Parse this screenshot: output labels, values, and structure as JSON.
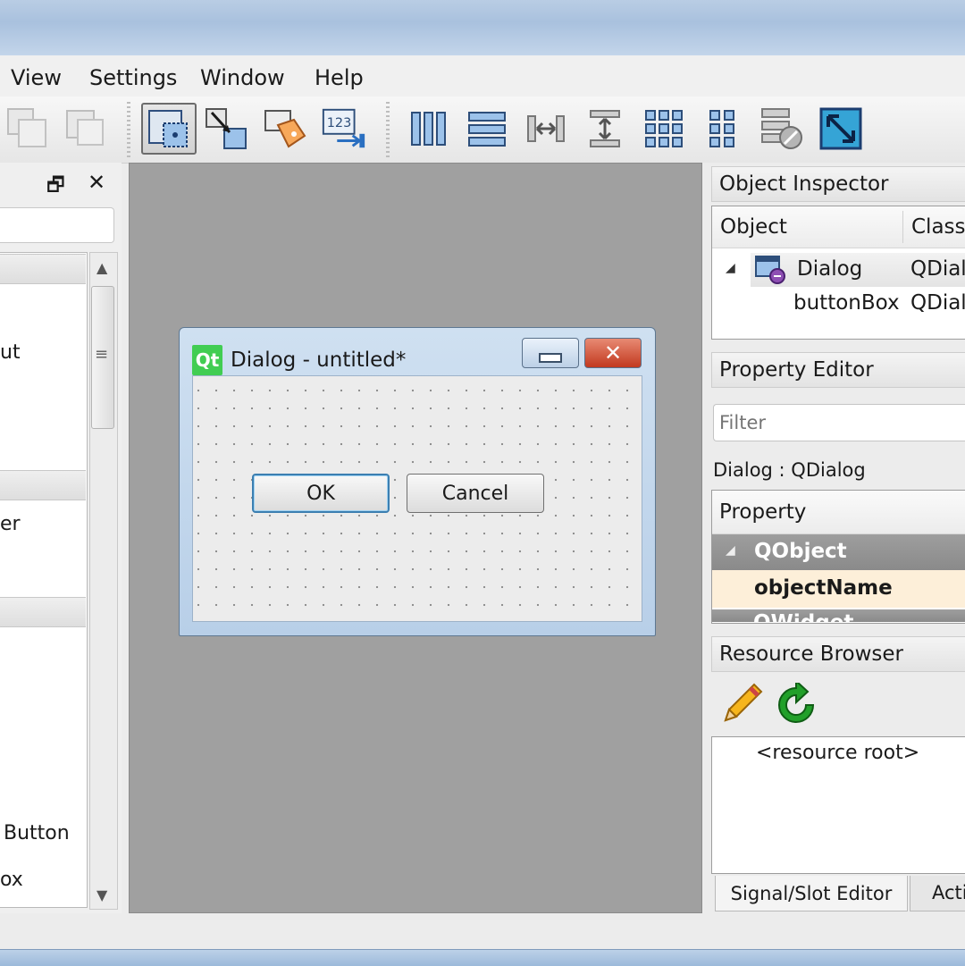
{
  "menu": [
    "View",
    "Settings",
    "Window",
    "Help"
  ],
  "colors": {
    "accent": "#41cd52",
    "canvas": "#a0a0a0",
    "highlight_row": "#fdefd9",
    "close": "#c2391f"
  },
  "toolbar": {
    "icons": [
      "copy-icon",
      "paste-icon",
      "edit-widgets-icon",
      "edit-signals-slots-icon",
      "edit-buddies-icon",
      "edit-tab-order-icon",
      "layout-horizontal-icon",
      "layout-vertical-icon",
      "layout-horizontal-splitter-icon",
      "layout-vertical-splitter-icon",
      "layout-grid-icon",
      "layout-form-icon",
      "break-layout-icon",
      "adjust-size-icon"
    ]
  },
  "widget_box": {
    "float_glyph": "🗗",
    "close_glyph": "✕",
    "items": [
      "ut",
      "er",
      "Button",
      "ox"
    ]
  },
  "dialog": {
    "logo": "Qt",
    "title": "Dialog - untitled*",
    "minimize_glyph": "▭",
    "close_glyph": "✕",
    "ok": "OK",
    "cancel": "Cancel"
  },
  "object_inspector": {
    "title": "Object Inspector",
    "col_object": "Object",
    "col_class": "Class",
    "rows": [
      {
        "object": "Dialog",
        "class": "QDial"
      },
      {
        "object": "buttonBox",
        "class": "QDial"
      }
    ]
  },
  "property_editor": {
    "title": "Property Editor",
    "filter_placeholder": "Filter",
    "context": "Dialog : QDialog",
    "col_property": "Property",
    "group": "QObject",
    "row": "objectName",
    "next_group": "QWidget"
  },
  "resource_browser": {
    "title": "Resource Browser",
    "root": "<resource root>"
  },
  "bottom_tabs": [
    "Signal/Slot Editor",
    "Acti"
  ]
}
